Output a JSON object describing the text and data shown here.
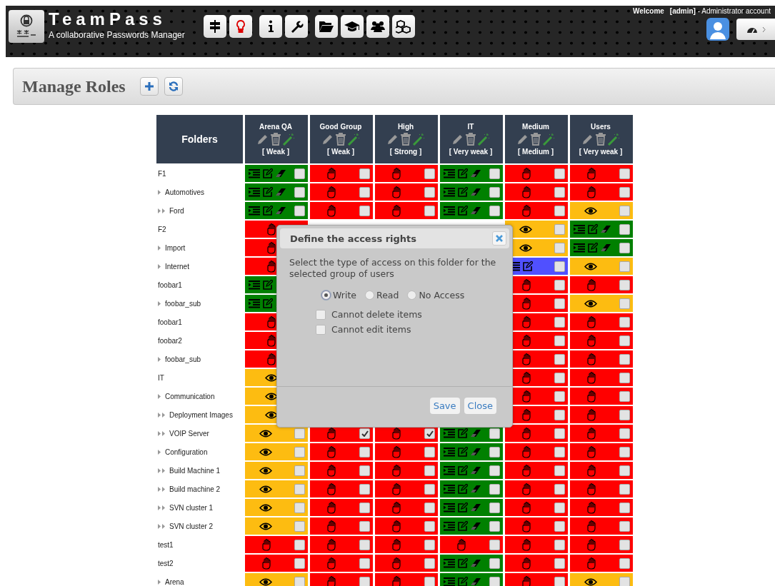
{
  "header": {
    "title": "TeamPass",
    "subtitle": "A collaborative Passwords Manager"
  },
  "user": {
    "welcome": "Welcome",
    "login": "[admin]",
    "role": "- Administrator account"
  },
  "page": {
    "title": "Manage Roles"
  },
  "table": {
    "corner": "Folders",
    "columns": [
      {
        "name": "Arena QA",
        "strength": "[ Weak ]"
      },
      {
        "name": "Good Group",
        "strength": "[ Weak ]"
      },
      {
        "name": "High",
        "strength": "[ Strong ]"
      },
      {
        "name": "IT",
        "strength": "[ Very weak ]"
      },
      {
        "name": "Medium",
        "strength": "[ Medium ]"
      },
      {
        "name": "Users",
        "strength": "[ Very weak ]"
      }
    ],
    "rows": [
      {
        "folder": "F1",
        "cells": [
          {
            "kind": "write",
            "checked": false
          },
          {
            "kind": "none",
            "checked": false
          },
          {
            "kind": "none",
            "checked": false
          },
          {
            "kind": "write",
            "checked": false
          },
          {
            "kind": "none",
            "checked": false
          },
          {
            "kind": "none",
            "checked": false
          }
        ],
        "children": [
          {
            "folder": "Automotives",
            "cells": [
              {
                "kind": "write",
                "checked": false
              },
              {
                "kind": "none",
                "checked": false
              },
              {
                "kind": "none",
                "checked": false
              },
              {
                "kind": "write",
                "checked": false
              },
              {
                "kind": "none",
                "checked": false
              },
              {
                "kind": "none",
                "checked": false
              }
            ],
            "children": [
              {
                "folder": "Ford",
                "cells": [
                  {
                    "kind": "write",
                    "checked": false
                  },
                  {
                    "kind": "none",
                    "checked": false
                  },
                  {
                    "kind": "none",
                    "checked": false
                  },
                  {
                    "kind": "write",
                    "checked": false
                  },
                  {
                    "kind": "none",
                    "checked": false
                  },
                  {
                    "kind": "read",
                    "checked": false
                  }
                ]
              }
            ]
          }
        ]
      },
      {
        "folder": "F2",
        "cells": [
          {
            "kind": "none"
          },
          null,
          null,
          null,
          {
            "kind": "read",
            "checked": false
          },
          {
            "kind": "write",
            "checked": false
          }
        ],
        "children": [
          {
            "folder": "Import",
            "cells": [
              {
                "kind": "none"
              },
              null,
              null,
              null,
              {
                "kind": "read",
                "checked": false
              },
              {
                "kind": "write",
                "checked": false
              }
            ]
          },
          {
            "folder": "Internet",
            "cells": [
              {
                "kind": "none"
              },
              null,
              null,
              null,
              {
                "kind": "write-no-delete",
                "checked": false
              },
              {
                "kind": "read",
                "checked": false
              }
            ]
          }
        ]
      },
      {
        "folder": "foobar1",
        "cells": [
          {
            "kind": "write"
          },
          null,
          null,
          null,
          {
            "kind": "none",
            "checked": false
          },
          {
            "kind": "none",
            "checked": false
          }
        ],
        "children": [
          {
            "folder": "foobar_sub",
            "cells": [
              {
                "kind": "write"
              },
              null,
              null,
              null,
              {
                "kind": "none",
                "checked": false
              },
              {
                "kind": "read",
                "checked": false
              }
            ]
          }
        ]
      },
      {
        "folder": "foobar1",
        "cells": [
          {
            "kind": "none"
          },
          null,
          null,
          null,
          {
            "kind": "none",
            "checked": false
          },
          {
            "kind": "none",
            "checked": false
          }
        ]
      },
      {
        "folder": "foobar2",
        "cells": [
          {
            "kind": "none"
          },
          null,
          null,
          null,
          {
            "kind": "none",
            "checked": false
          },
          {
            "kind": "none",
            "checked": false
          }
        ],
        "children": [
          {
            "folder": "foobar_sub",
            "cells": [
              {
                "kind": "none"
              },
              null,
              null,
              null,
              {
                "kind": "none",
                "checked": false
              },
              {
                "kind": "none",
                "checked": false
              }
            ]
          }
        ]
      },
      {
        "folder": "IT",
        "cells": [
          {
            "kind": "read"
          },
          null,
          null,
          null,
          {
            "kind": "none",
            "checked": false
          },
          {
            "kind": "none",
            "checked": false
          }
        ],
        "children": [
          {
            "folder": "Communication",
            "cells": [
              {
                "kind": "read"
              },
              null,
              null,
              null,
              {
                "kind": "none",
                "checked": false
              },
              {
                "kind": "none",
                "checked": false
              }
            ],
            "children": [
              {
                "folder": "Deployment Images",
                "cells": [
                  {
                    "kind": "read"
                  },
                  null,
                  null,
                  null,
                  {
                    "kind": "none",
                    "checked": false
                  },
                  {
                    "kind": "none",
                    "checked": false
                  }
                ]
              },
              {
                "folder": "VOIP Server",
                "cells": [
                  {
                    "kind": "read",
                    "checked": false
                  },
                  {
                    "kind": "none",
                    "checked": true
                  },
                  {
                    "kind": "none",
                    "checked": true
                  },
                  {
                    "kind": "write",
                    "checked": false
                  },
                  {
                    "kind": "none",
                    "checked": false
                  },
                  {
                    "kind": "none",
                    "checked": false
                  }
                ]
              }
            ]
          },
          {
            "folder": "Configuration",
            "cells": [
              {
                "kind": "read",
                "checked": false
              },
              {
                "kind": "none",
                "checked": false
              },
              {
                "kind": "none",
                "checked": false
              },
              {
                "kind": "write",
                "checked": false
              },
              {
                "kind": "none",
                "checked": false
              },
              {
                "kind": "none",
                "checked": false
              }
            ],
            "children": [
              {
                "folder": "Build Machine 1",
                "cells": [
                  {
                    "kind": "read",
                    "checked": false
                  },
                  {
                    "kind": "none",
                    "checked": false
                  },
                  {
                    "kind": "none",
                    "checked": false
                  },
                  {
                    "kind": "write",
                    "checked": false
                  },
                  {
                    "kind": "none",
                    "checked": false
                  },
                  {
                    "kind": "none",
                    "checked": false
                  }
                ]
              },
              {
                "folder": "Build machine 2",
                "cells": [
                  {
                    "kind": "read",
                    "checked": false
                  },
                  {
                    "kind": "none",
                    "checked": false
                  },
                  {
                    "kind": "none",
                    "checked": false
                  },
                  {
                    "kind": "write",
                    "checked": false
                  },
                  {
                    "kind": "none",
                    "checked": false
                  },
                  {
                    "kind": "none",
                    "checked": false
                  }
                ]
              },
              {
                "folder": "SVN cluster 1",
                "cells": [
                  {
                    "kind": "read",
                    "checked": false
                  },
                  {
                    "kind": "none",
                    "checked": false
                  },
                  {
                    "kind": "none",
                    "checked": false
                  },
                  {
                    "kind": "write",
                    "checked": false
                  },
                  {
                    "kind": "none",
                    "checked": false
                  },
                  {
                    "kind": "none",
                    "checked": false
                  }
                ]
              },
              {
                "folder": "SVN cluster 2",
                "cells": [
                  {
                    "kind": "read",
                    "checked": false
                  },
                  {
                    "kind": "none",
                    "checked": false
                  },
                  {
                    "kind": "none",
                    "checked": false
                  },
                  {
                    "kind": "write",
                    "checked": false
                  },
                  {
                    "kind": "none",
                    "checked": false
                  },
                  {
                    "kind": "none",
                    "checked": false
                  }
                ]
              }
            ]
          }
        ]
      },
      {
        "folder": "test1",
        "cells": [
          {
            "kind": "none",
            "checked": false
          },
          {
            "kind": "none",
            "checked": false
          },
          {
            "kind": "none",
            "checked": false
          },
          {
            "kind": "none",
            "checked": false
          },
          {
            "kind": "none",
            "checked": false
          },
          {
            "kind": "none",
            "checked": false
          }
        ]
      },
      {
        "folder": "test2",
        "cells": [
          {
            "kind": "none",
            "checked": false
          },
          {
            "kind": "none",
            "checked": false
          },
          {
            "kind": "none",
            "checked": false
          },
          {
            "kind": "write",
            "checked": false
          },
          {
            "kind": "none",
            "checked": false
          },
          {
            "kind": "none",
            "checked": false
          }
        ],
        "children": [
          {
            "folder": "Arena",
            "cells": [
              {
                "kind": "read",
                "checked": false
              },
              {
                "kind": "none",
                "checked": false
              },
              {
                "kind": "none",
                "checked": false
              },
              {
                "kind": "write",
                "checked": false
              },
              {
                "kind": "none",
                "checked": false
              },
              {
                "kind": "read",
                "checked": false
              }
            ]
          }
        ]
      }
    ]
  },
  "dialog": {
    "title": "Define the access rights",
    "message": "Select the type of access on this folder for the selected group of users",
    "access_options": [
      {
        "label": "Write",
        "selected": true
      },
      {
        "label": "Read",
        "selected": false
      },
      {
        "label": "No Access",
        "selected": false
      }
    ],
    "restrictions": [
      {
        "label": "Cannot delete items",
        "checked": false
      },
      {
        "label": "Cannot edit items",
        "checked": false
      }
    ],
    "buttons": [
      "Save",
      "Close"
    ]
  }
}
